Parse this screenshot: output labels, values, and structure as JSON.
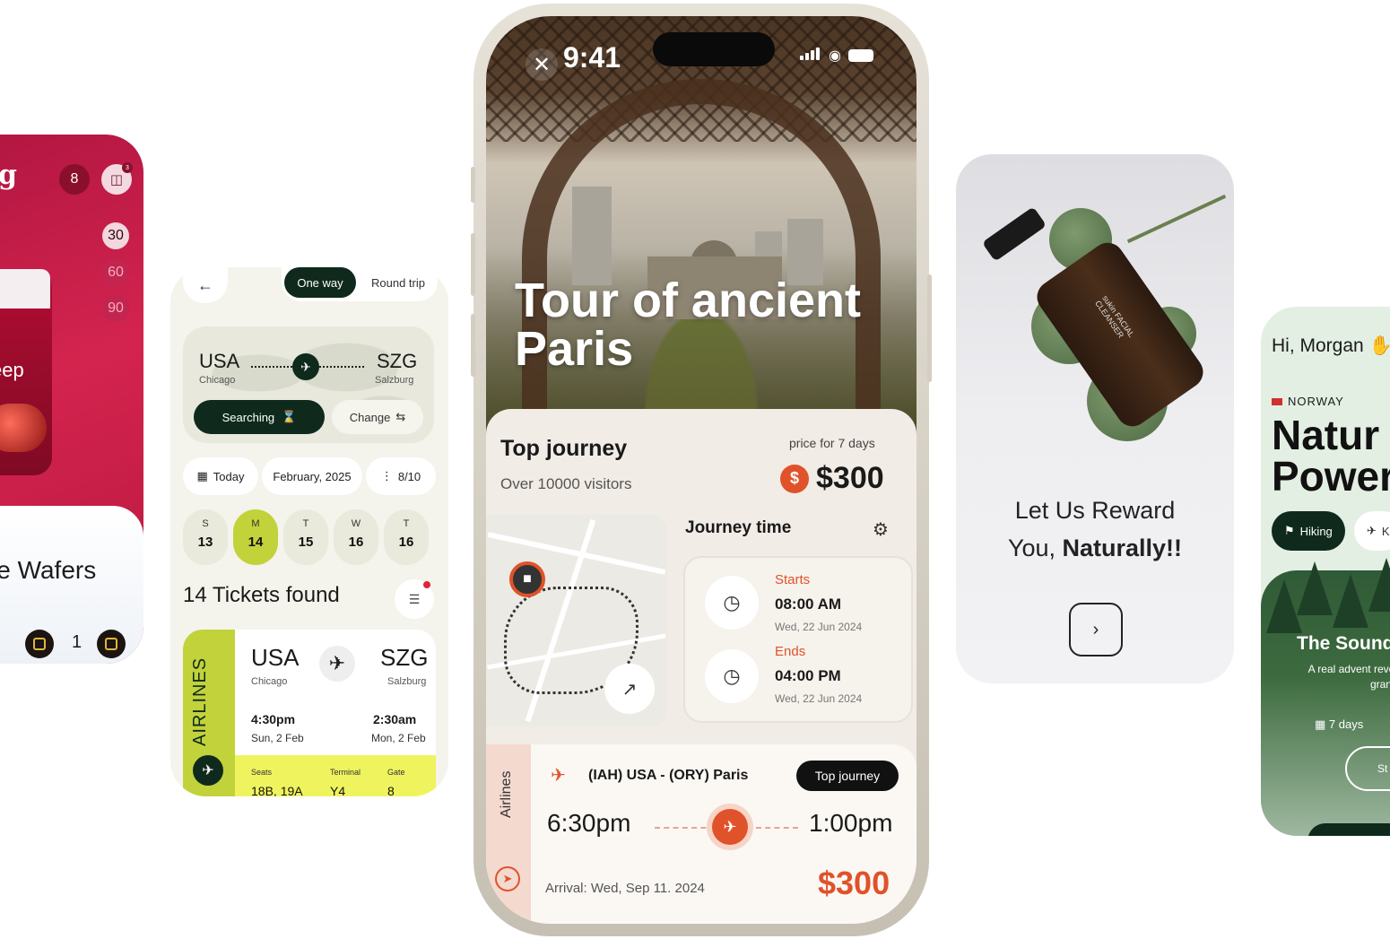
{
  "candy_card": {
    "logo_fragment": "g",
    "counter_badge": "8",
    "cart_count": "3",
    "quantity_options": [
      "30",
      "60",
      "90"
    ],
    "jar_label": "eep",
    "product_title": "le Wafers",
    "quantity": "1"
  },
  "flight_card": {
    "trip_types": {
      "one_way": "One way",
      "round_trip": "Round trip"
    },
    "origin": {
      "code": "USA",
      "city": "Chicago"
    },
    "destination": {
      "code": "SZG",
      "city": "Salzburg"
    },
    "searching_label": "Searching",
    "change_label": "Change",
    "chips": {
      "today": "Today",
      "month": "February, 2025",
      "passengers": "8/10"
    },
    "days": [
      {
        "letter": "S",
        "num": "13"
      },
      {
        "letter": "M",
        "num": "14"
      },
      {
        "letter": "T",
        "num": "15"
      },
      {
        "letter": "W",
        "num": "16"
      },
      {
        "letter": "T",
        "num": "16"
      }
    ],
    "tickets_found": "14 Tickets found",
    "ticket": {
      "airline_label": "AIRLINES",
      "from_code": "USA",
      "from_city": "Chicago",
      "to_code": "SZG",
      "to_city": "Salzburg",
      "dep_time": "4:30pm",
      "dep_date": "Sun, 2 Feb",
      "arr_time": "2:30am",
      "arr_date": "Mon, 2 Feb",
      "seats_label": "Seats",
      "seats": "18B, 19A",
      "terminal_label": "Terminal",
      "terminal": "Y4",
      "gate_label": "Gate",
      "gate": "8"
    }
  },
  "phone": {
    "status_time": "9:41",
    "hero_title": "Tour of ancient Paris",
    "top_journey_title": "Top journey",
    "visitors": "Over 10000 visitors",
    "price_label": "price for 7 days",
    "price": "$300",
    "journey_time_label": "Journey time",
    "starts_label": "Starts",
    "start_time": "08:00 AM",
    "start_date": "Wed, 22 Jun 2024",
    "ends_label": "Ends",
    "end_time": "04:00 PM",
    "end_date": "Wed, 22 Jun 2024",
    "airlines_label": "Airlines",
    "route": "(IAH) USA - (ORY) Paris",
    "badge": "Top journey",
    "dep_time": "6:30pm",
    "arr_time": "1:00pm",
    "arrival": "Arrival: Wed, Sep 11. 2024",
    "fare": "$300"
  },
  "skincare_card": {
    "bottle_label": "sukin FACIAL CLEANSER",
    "message_line1": "Let Us Reward",
    "message_line2_prefix": "You, ",
    "message_line2_bold": "Naturally!!"
  },
  "nature_card": {
    "greeting": "Hi, Morgan",
    "country": "NORWAY",
    "headline_line1": "Natur",
    "headline_line2": "Power",
    "pill_hiking": "Hiking",
    "pill_other": "K",
    "feature_title": "The Sound",
    "feature_desc": "A real advent reveals its grand pure",
    "duration": "7 days",
    "start_label": "St"
  },
  "colors": {
    "accent_orange": "#e0522a",
    "dark_green": "#0f2a1d",
    "lime": "#c2d23a",
    "candy_red": "#c8204a"
  }
}
